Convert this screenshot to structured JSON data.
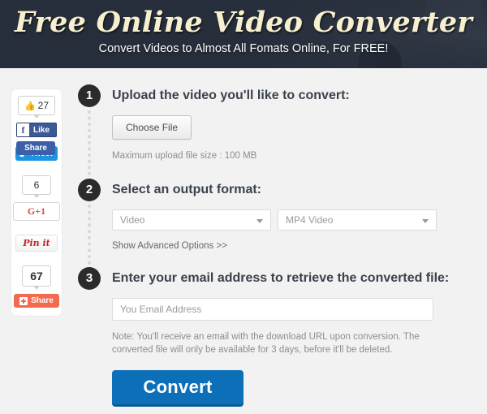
{
  "header": {
    "title": "Free Online Video Converter",
    "tagline": "Convert Videos to Almost All Fomats Online, For FREE!",
    "bg_color": "#272e3b",
    "title_color": "#f7f0cf"
  },
  "social": {
    "facebook": {
      "count": "27",
      "thumb_icon": "thumbs-up-icon",
      "like_label": "Like",
      "f_mark": "f"
    },
    "twitter": {
      "share_label": "Share",
      "tweet_label": "Tweet",
      "bird_icon": "twitter-bird-icon"
    },
    "googleplus": {
      "count": "6",
      "label": "G+1"
    },
    "pinterest": {
      "label": "Pin it"
    },
    "addthis": {
      "count": "67",
      "label": "Share",
      "plus_icon": "plus-square-icon",
      "color": "#f26a4f"
    }
  },
  "steps": [
    {
      "number": "1",
      "title": "Upload the video you'll like to convert:",
      "choose_file_label": "Choose File",
      "hint": "Maximum upload file size : 100 MB"
    },
    {
      "number": "2",
      "title": "Select an output format:",
      "format_category": "Video",
      "format_type": "MP4 Video",
      "advanced_link": "Show Advanced Options >>"
    },
    {
      "number": "3",
      "title": "Enter your email address to retrieve the converted file:",
      "email_placeholder": "You Email Address",
      "email_value": "",
      "note": "Note: You'll receive an email with the download URL upon conversion. The converted file will only be available for 3 days, before it'll be deleted.",
      "convert_label": "Convert",
      "convert_color": "#0c6fb8"
    }
  ]
}
